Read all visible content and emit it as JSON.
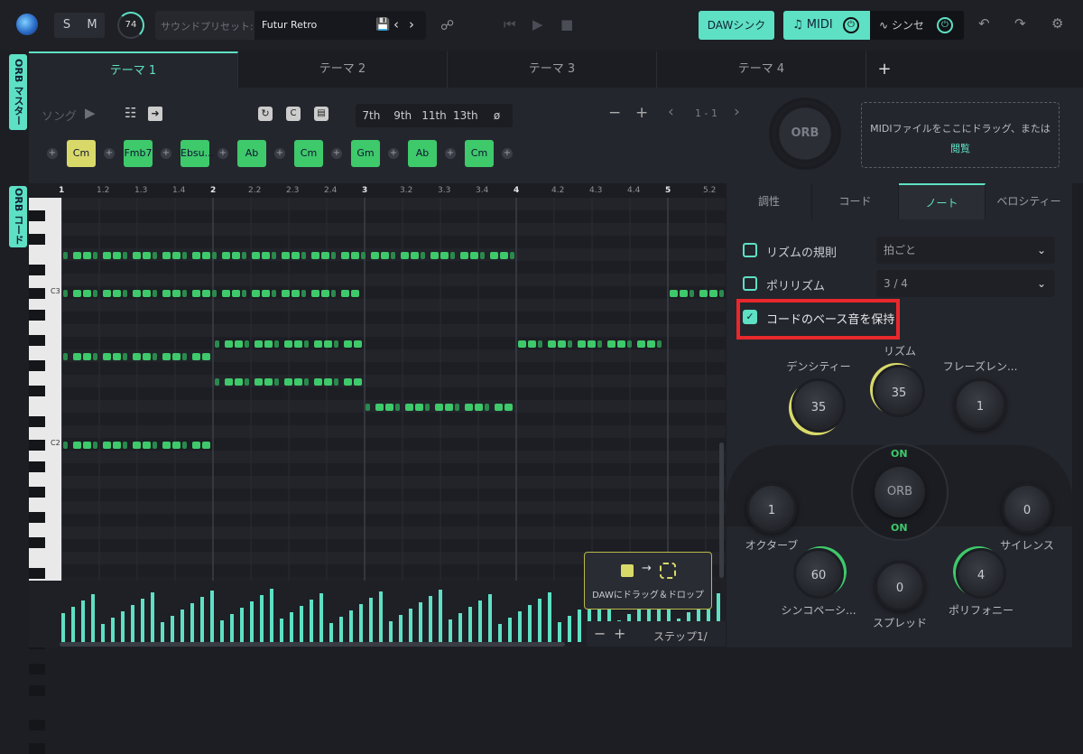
{
  "toolbar": {
    "solo_label": "S",
    "mute_label": "M",
    "tempo_knob": "74",
    "preset_label": "サウンドプリセット:",
    "preset_value": "Futur Retro",
    "daw_sync_label": "DAWシンク",
    "midi_label": "MIDI",
    "synth_label": "シンセ"
  },
  "theme_tabs": [
    "テーマ 1",
    "テーマ 2",
    "テーマ 3",
    "テーマ 4"
  ],
  "add_tab_label": "+",
  "side_tags": {
    "master": "ORB マスター",
    "chord": "ORB コード"
  },
  "song": {
    "label": "ソング",
    "extensions": [
      "7th",
      "9th",
      "11th",
      "13th",
      "ø"
    ],
    "page": "1 - 1",
    "minus": "−",
    "plus": "+",
    "chords": [
      "Cm",
      "Fmb7",
      "Ebsu...",
      "Ab",
      "Cm",
      "Gm",
      "Ab",
      "Cm"
    ],
    "chord_colors": [
      "#d9d96a",
      "#3ec96b",
      "#3ec96b",
      "#3ec96b",
      "#3ec96b",
      "#3ec96b",
      "#3ec96b",
      "#3ec96b"
    ],
    "orb_label": "ORB",
    "drop_text": "MIDIファイルをここにドラッグ、または",
    "drop_link": "閲覧"
  },
  "ruler": [
    "1",
    "1.2",
    "1.3",
    "1.4",
    "2",
    "2.2",
    "2.3",
    "2.4",
    "3",
    "3.2",
    "3.3",
    "3.4",
    "4",
    "4.2",
    "4.3",
    "4.4",
    "5",
    "5.2"
  ],
  "key_labels": {
    "c3": "C3",
    "c2": "C2"
  },
  "panel": {
    "tabs": [
      "調性",
      "コード",
      "ノート",
      "ベロシティー"
    ],
    "active_tab": 2,
    "rhythm_rule_label": "リズムの規則",
    "rhythm_rule_value": "拍ごと",
    "polyrhythm_label": "ポリリズム",
    "polyrhythm_value": "3 / 4",
    "keep_bass_label": "コードのベース音を保持",
    "keep_bass_checked": true,
    "knobs": {
      "density": {
        "label": "デンシティー",
        "value": "35"
      },
      "rhythm": {
        "label": "リズム",
        "value": "35"
      },
      "phrase_length": {
        "label": "フレーズレン...",
        "value": "1"
      },
      "octave": {
        "label": "オクターブ",
        "value": "1"
      },
      "silence": {
        "label": "サイレンス",
        "value": "0"
      },
      "syncopation": {
        "label": "シンコペーシ...",
        "value": "60"
      },
      "spread": {
        "label": "スプレッド",
        "value": "0"
      },
      "polyphony": {
        "label": "ポリフォニー",
        "value": "4"
      }
    },
    "orb_label": "ORB",
    "on_top": "ON",
    "on_bottom": "ON"
  },
  "drag_tip": "DAWにドラッグ＆ドロップ",
  "step_label": "ステップ1/",
  "highlight_color": "#e8282c",
  "accent_color": "#5ee0c4"
}
